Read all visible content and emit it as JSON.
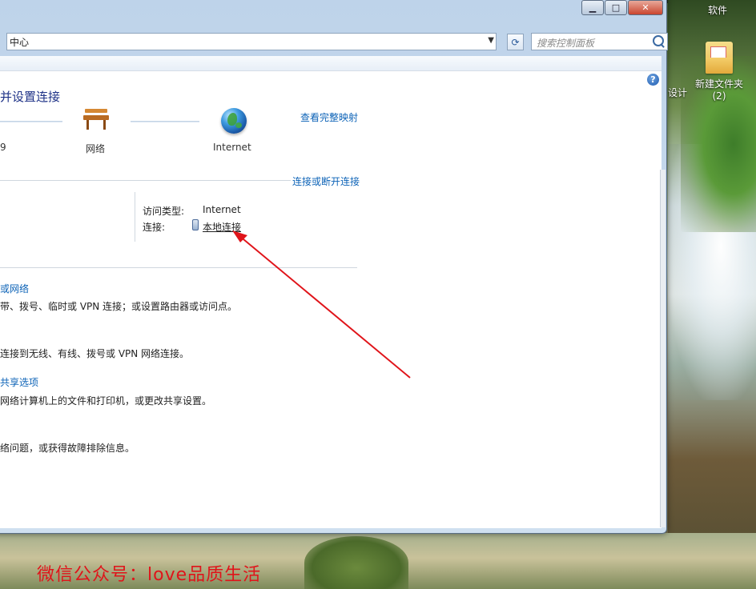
{
  "desktop": {
    "top_label": "软件",
    "icon_label_line1": "新建文件夹",
    "icon_label_line2": "(2)",
    "cut_label": "设计"
  },
  "window": {
    "caption": {
      "minimize": "▁",
      "maximize": "□",
      "close": "✕"
    },
    "address_text": "中心",
    "search_placeholder": "搜索控制面板"
  },
  "content": {
    "title": "并设置连接",
    "view_full_map": "查看完整映射",
    "nodes": {
      "left_label": "9",
      "network_label": "网络",
      "internet_label": "Internet"
    },
    "connect_disconnect": "连接或断开连接",
    "access_type_label": "访问类型:",
    "access_type_value": "Internet",
    "connections_label": "连接:",
    "connections_value": "本地连接",
    "sections": [
      {
        "link": "或网络",
        "desc": "带、拨号、临时或 VPN 连接；或设置路由器或访问点。"
      },
      {
        "link": "",
        "desc": "连接到无线、有线、拨号或 VPN 网络连接。"
      },
      {
        "link": "共享选项",
        "desc": "网络计算机上的文件和打印机，或更改共享设置。"
      },
      {
        "link": "",
        "desc": "络问题，或获得故障排除信息。"
      }
    ]
  },
  "watermark": "微信公众号：love品质生活",
  "colors": {
    "link": "#0d63b7",
    "title": "#1e3287",
    "arrow": "#e0141a"
  }
}
